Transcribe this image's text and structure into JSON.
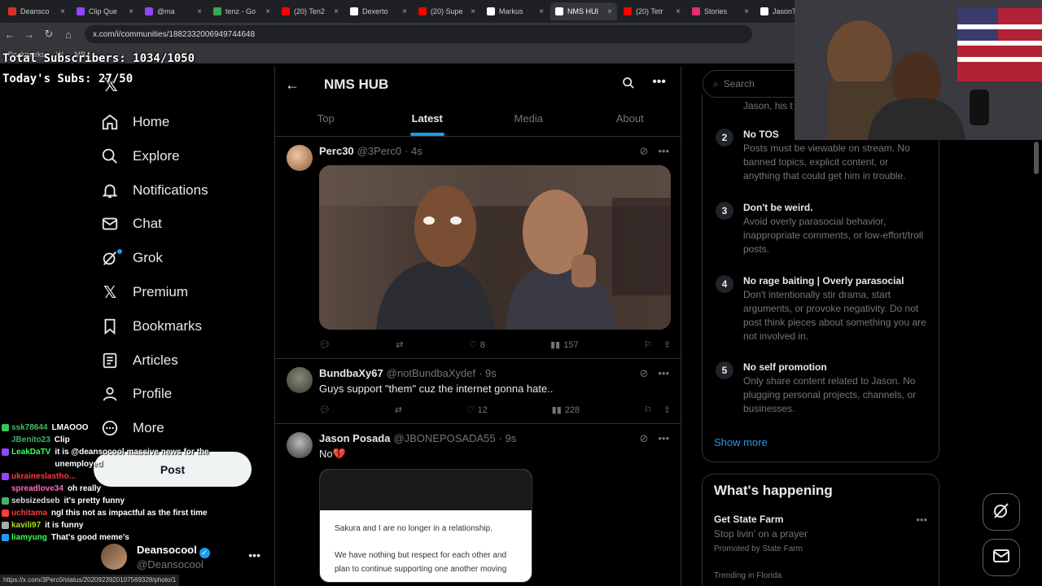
{
  "browser": {
    "tabs": [
      {
        "label": "Deansco",
        "color": "#d93025",
        "active": false
      },
      {
        "label": "Clip Que",
        "color": "#9146ff",
        "active": false
      },
      {
        "label": "@ma",
        "color": "#9146ff",
        "active": false
      },
      {
        "label": "tenz - Go",
        "color": "#34a853",
        "active": false
      },
      {
        "label": "(20) Ten2",
        "color": "#ff0000",
        "active": false
      },
      {
        "label": "Dexerto",
        "color": "#ffffff",
        "active": false
      },
      {
        "label": "(20) Supe",
        "color": "#ff0000",
        "active": false
      },
      {
        "label": "Markus",
        "color": "#ffffff",
        "active": false
      },
      {
        "label": "NMS HUI",
        "color": "#ffffff",
        "active": true
      },
      {
        "label": "(20) Tetr",
        "color": "#ff0000",
        "active": false
      },
      {
        "label": "Stories",
        "color": "#e1306c",
        "active": false
      },
      {
        "label": "JasonThe",
        "color": "#ffffff",
        "active": false
      }
    ],
    "url": "x.com/i/communities/1882332006949744648",
    "bookmarks": [
      "Bookmarks",
      "W",
      "MB"
    ],
    "status_url": "https://x.com/3Perc0/status/2020923920107569328/photo/1"
  },
  "overlay": {
    "total_subs": "Total Subscribers: 1034/1050",
    "today_subs": "Today's Subs: 27/50"
  },
  "nav": {
    "items": [
      {
        "label": "Home",
        "icon": "home-icon"
      },
      {
        "label": "Explore",
        "icon": "search-icon"
      },
      {
        "label": "Notifications",
        "icon": "bell-icon"
      },
      {
        "label": "Chat",
        "icon": "mail-icon"
      },
      {
        "label": "Grok",
        "icon": "grok-icon"
      },
      {
        "label": "Premium",
        "icon": "x-icon"
      },
      {
        "label": "Bookmarks",
        "icon": "bookmark-icon"
      },
      {
        "label": "Articles",
        "icon": "article-icon"
      },
      {
        "label": "Profile",
        "icon": "person-icon"
      },
      {
        "label": "More",
        "icon": "more-circle-icon"
      }
    ],
    "post_label": "Post",
    "account": {
      "name": "Deansocool",
      "handle": "@Deansocool"
    }
  },
  "chat": [
    {
      "user": "ssk78644",
      "msg": "LMAOOO",
      "color": "#39c45f",
      "badge": "#39c45f"
    },
    {
      "user": "JBenito23",
      "msg": "Clip",
      "color": "#3cb371",
      "badge": ""
    },
    {
      "user": "LeakDaTV",
      "msg": "it is @deansocool massive news for the unemployed",
      "color": "#39ff5a",
      "badge": "#9146ff"
    },
    {
      "user": "ukraineslastho...",
      "msg": "",
      "color": "#ff3b3b",
      "badge": "#9146ff"
    },
    {
      "user": "spreadlove34",
      "msg": "oh really",
      "color": "#ff69b4",
      "badge": ""
    },
    {
      "user": "sebsizedseb",
      "msg": "it's pretty funny",
      "color": "#dddddd",
      "badge": "#3cb371"
    },
    {
      "user": "uchitama",
      "msg": "ngl this not as impactful as the first time",
      "color": "#ff3b3b",
      "badge": "#ff3b3b"
    },
    {
      "user": "kavili97",
      "msg": "it is funny",
      "color": "#b0e020",
      "badge": "#aaaaaa"
    },
    {
      "user": "liamyung",
      "msg": "That's good meme's",
      "color": "#39ff5a",
      "badge": "#1d9bf0"
    }
  ],
  "community": {
    "title": "NMS HUB",
    "tabs": [
      "Top",
      "Latest",
      "Media",
      "About"
    ],
    "selected_tab": "Latest"
  },
  "tweets": [
    {
      "name": "Perc30",
      "handle": "@3Perc0",
      "time": "· 4s",
      "text": "",
      "replies": "",
      "reposts": "",
      "likes": "8",
      "views": "157",
      "has_media": true
    },
    {
      "name": "BundbaXy67",
      "handle": "@notBundbaXydef",
      "time": "· 9s",
      "text": "Guys support \"them\" cuz the internet gonna hate..",
      "replies": "",
      "reposts": "",
      "likes": "12",
      "views": "228",
      "has_media": false
    },
    {
      "name": "Jason Posada",
      "handle": "@JBONEPOSADA55",
      "time": "· 9s",
      "text": "No💔",
      "card_line1": "Sakura and I are no longer in a relationship.",
      "card_line2": "We have nothing but respect for each other and plan to continue supporting one another moving"
    }
  ],
  "right": {
    "search_placeholder": "Search",
    "rule1_tail": "Jason, his t",
    "rules": [
      {
        "num": "2",
        "title": "No TOS",
        "body": "Posts must be viewable on stream. No banned topics, explicit content, or anything that could get him in trouble."
      },
      {
        "num": "3",
        "title": "Don't be weird.",
        "body": "Avoid overly parasocial behavior, inappropriate comments, or low-effort/troll posts."
      },
      {
        "num": "4",
        "title": "No rage baiting | Overly parasocial",
        "body": "Don't intentionally stir drama, start arguments, or provoke negativity. Do not post think pieces about something you are not involved in."
      },
      {
        "num": "5",
        "title": "No self promotion",
        "body": "Only share content related to Jason. No plugging personal projects, channels, or businesses."
      }
    ],
    "show_more": "Show more",
    "happening": {
      "title": "What's happening",
      "item_name": "Get State Farm",
      "item_sub": "Stop livin' on a prayer",
      "item_promo": "Promoted by State Farm",
      "trend": "Trending in Florida"
    }
  },
  "colors": {
    "accent": "#1d9bf0",
    "bg": "#000000",
    "border": "#2f3336",
    "muted": "#71767b"
  }
}
